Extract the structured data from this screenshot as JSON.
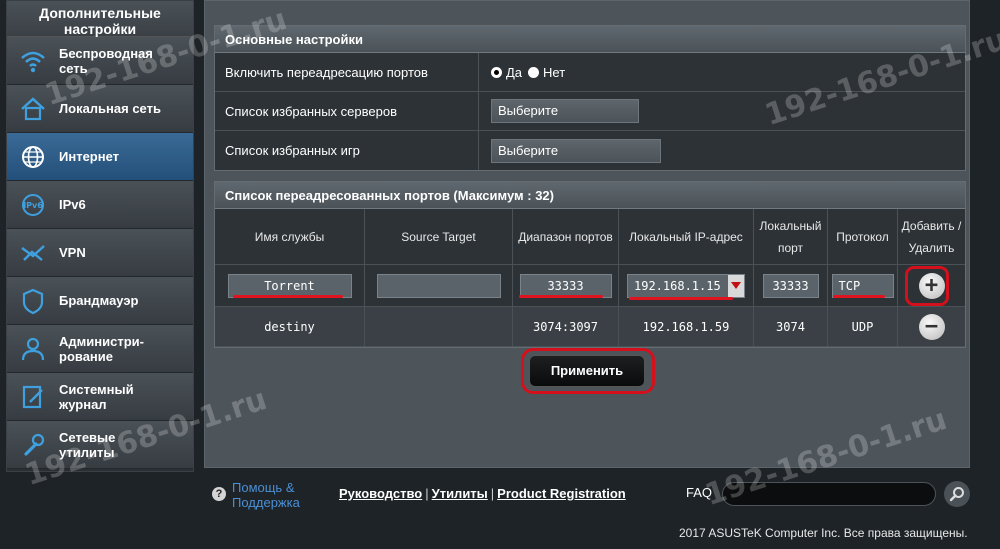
{
  "sidebar": {
    "header": "Дополнительные настройки",
    "items": [
      {
        "label": "Беспроводная сеть",
        "icon": "wifi-icon"
      },
      {
        "label": "Локальная сеть",
        "icon": "home-icon"
      },
      {
        "label": "Интернет",
        "icon": "globe-icon",
        "active": true
      },
      {
        "label": "IPv6",
        "icon": "ipv6-icon"
      },
      {
        "label": "VPN",
        "icon": "vpn-icon"
      },
      {
        "label": "Брандмауэр",
        "icon": "shield-icon"
      },
      {
        "label": "Администри-рование",
        "icon": "user-icon"
      },
      {
        "label": "Системный журнал",
        "icon": "log-icon"
      },
      {
        "label": "Сетевые утилиты",
        "icon": "wrench-icon"
      }
    ]
  },
  "basic": {
    "title": "Основные настройки",
    "enable_label": "Включить переадресацию портов",
    "yes": "Да",
    "no": "Нет",
    "servers_label": "Список избранных серверов",
    "servers_value": "Выберите",
    "games_label": "Список избранных игр",
    "games_value": "Выберите"
  },
  "ports": {
    "title": "Список переадресованных портов (Максимум : 32)",
    "headers": {
      "service": "Имя службы",
      "source": "Source Target",
      "range": "Диапазон портов",
      "local_ip": "Локальный IP-адрес",
      "local_port": "Локальный порт",
      "protocol": "Протокол",
      "add_remove": "Добавить / Удалить"
    },
    "input_row": {
      "service": "Torrent",
      "source": "",
      "range": "33333",
      "local_ip": "192.168.1.15",
      "local_port": "33333",
      "protocol": "TCP"
    },
    "rows": [
      {
        "service": "destiny",
        "source": "",
        "range": "3074:3097",
        "local_ip": "192.168.1.59",
        "local_port": "3074",
        "protocol": "UDP"
      }
    ]
  },
  "apply_label": "Применить",
  "footer": {
    "help": "Помощь & Поддержка",
    "manual": "Руководство",
    "utilities": "Утилиты",
    "registration": "Product Registration",
    "faq": "FAQ",
    "copyright": "2017 ASUSTeK Computer Inc. Все права защищены."
  },
  "watermark": "192-168-0-1.ru",
  "colors": {
    "accent_red": "#d3101c",
    "active_blue": "#2c5e8c",
    "help_link": "#4b8fd4"
  }
}
